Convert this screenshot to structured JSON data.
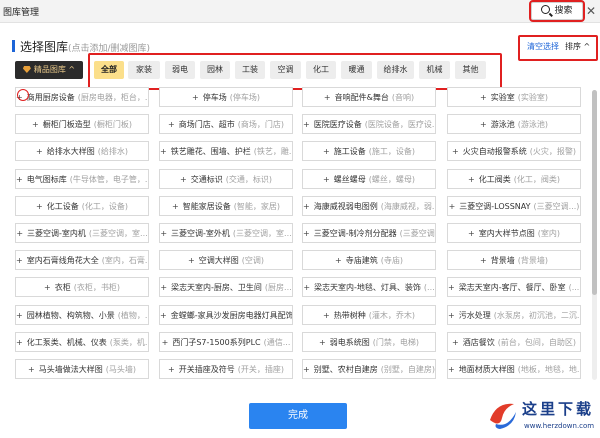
{
  "window": {
    "title": "图库管理",
    "search_label": "搜索"
  },
  "header": {
    "title": "选择图库",
    "hint": "(点击添加/删减图库)",
    "clear_label": "清空选择",
    "sort_label": "排序 ^"
  },
  "premium_label": "精品图库 ^",
  "categories": [
    "全部",
    "家装",
    "弱电",
    "园林",
    "工装",
    "空调",
    "化工",
    "暖通",
    "给排水",
    "机械",
    "其他"
  ],
  "active_category": "全部",
  "items": [
    [
      "商用厨房设备",
      "(厨房电器，柜台，...",
      "停车场",
      "(停车场)",
      "音响配件&舞台",
      "(音响)",
      "实验室",
      "(实验室)"
    ],
    [
      "橱柜门板造型",
      "(橱柜门板)",
      "商场门店、超市",
      "(商场，门店)",
      "医院医疗设备",
      "(医院设备，医疗设...",
      "游泳池",
      "(游泳池)"
    ],
    [
      "给排水大样图",
      "(给排水)",
      "铁艺雕花、围墙、护栏",
      "(铁艺，雕...",
      "施工设备",
      "(施工，设备)",
      "火灾自动报警系统",
      "(火灾，报警)"
    ],
    [
      "电气图标库",
      "(牛导体管，电子管，...",
      "交通标识",
      "(交通，标识)",
      "螺丝螺母",
      "(螺丝，螺母)",
      "化工阀类",
      "(化工，阀类)"
    ],
    [
      "化工设备",
      "(化工，设备)",
      "智能家居设备",
      "(智能，家居)",
      "海康威视弱电图例",
      "(海康威视，弱...",
      "三菱空调-LOSSNAY",
      "(三菱空调...)"
    ],
    [
      "三菱空调-室内机",
      "(三菱空调，室...",
      "三菱空调-室外机",
      "(三菱空调，室...",
      "三菱空调-制冷剂分配器",
      "(三菱空调...",
      "室内大样节点图",
      "(室内)"
    ],
    [
      "室内石膏线角花大全",
      "(室内，石膏...",
      "空调大样图",
      "(空调)",
      "寺庙建筑",
      "(寺庙)",
      "背景墙",
      "(背景墙)"
    ],
    [
      "衣柜",
      "(衣柜，书柜)",
      "梁志天室内-厨房、卫生间",
      "(厨房...",
      "梁志天室内-地毯、灯具、装饰",
      "(...",
      "梁志天室内-客厅、餐厅、卧室",
      "(...)"
    ],
    [
      "园林植物、构筑物、小景",
      "(植物，...",
      "金螳螂-家具沙发厨房电器灯具配饰",
      "",
      "热带树种",
      "(灌木，乔木)",
      "污水处理",
      "(水泵房，初沉池，二沉..."
    ],
    [
      "化工泵类、机械、仪表",
      "(泵类，机...",
      "西门子S7-1500系列PLC",
      "(通信...",
      "弱电系统图",
      "(门禁，电梯)",
      "酒店餐饮",
      "(前台，包间，自助区)"
    ],
    [
      "马头墙做法大样图",
      "(马头墙)",
      "开关插座及符号",
      "(开关，插座)",
      "别墅、农村自建房",
      "(别墅，自建房)",
      "地面材质大样图",
      "(地板，地毯，地..."
    ]
  ],
  "finish_label": "完成",
  "watermark": {
    "text": "这里下载",
    "url": "www.herzdown.com"
  }
}
